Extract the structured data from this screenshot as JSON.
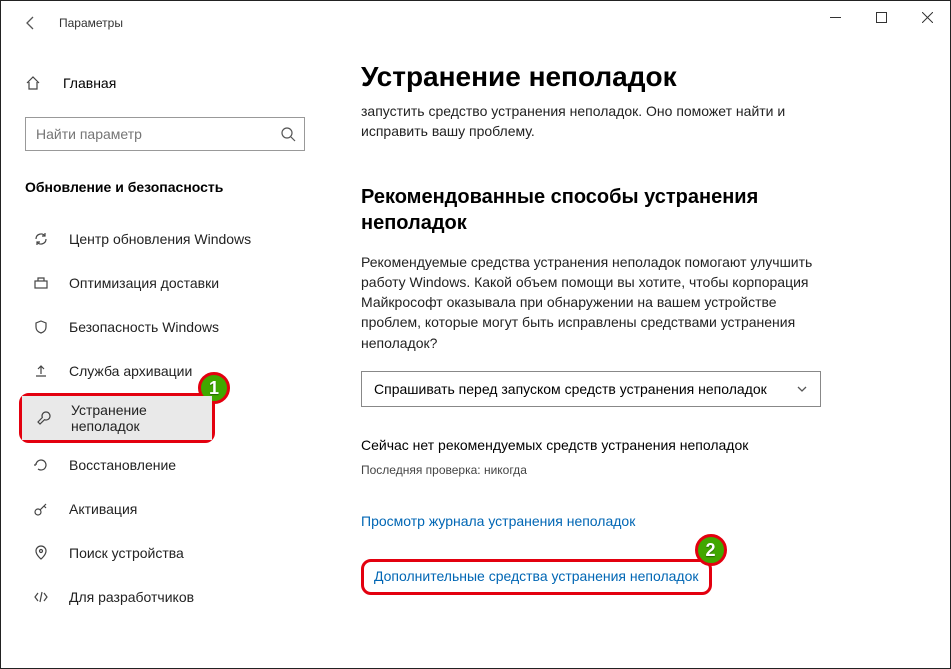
{
  "titlebar": {
    "title": "Параметры"
  },
  "sidebar": {
    "home": "Главная",
    "search_placeholder": "Найти параметр",
    "section": "Обновление и безопасность",
    "items": [
      {
        "label": "Центр обновления Windows"
      },
      {
        "label": "Оптимизация доставки"
      },
      {
        "label": "Безопасность Windows"
      },
      {
        "label": "Служба архивации"
      },
      {
        "label": "Устранение неполадок"
      },
      {
        "label": "Восстановление"
      },
      {
        "label": "Активация"
      },
      {
        "label": "Поиск устройства"
      },
      {
        "label": "Для разработчиков"
      }
    ]
  },
  "content": {
    "h1": "Устранение неполадок",
    "intro": "запустить средство устранения неполадок. Оно поможет найти и исправить вашу проблему.",
    "h2": "Рекомендованные способы устранения неполадок",
    "desc": "Рекомендуемые средства устранения неполадок помогают улучшить работу Windows. Какой объем помощи вы хотите, чтобы корпорация Майкрософт оказывала при обнаружении на вашем устройстве проблем, которые могут быть исправлены средствами устранения неполадок?",
    "dropdown": "Спрашивать перед запуском средств устранения неполадок",
    "status": "Сейчас нет рекомендуемых средств устранения неполадок",
    "last_check": "Последняя проверка: никогда",
    "link_history": "Просмотр журнала устранения неполадок",
    "link_more": "Дополнительные средства устранения неполадок"
  },
  "badges": {
    "one": "1",
    "two": "2"
  }
}
